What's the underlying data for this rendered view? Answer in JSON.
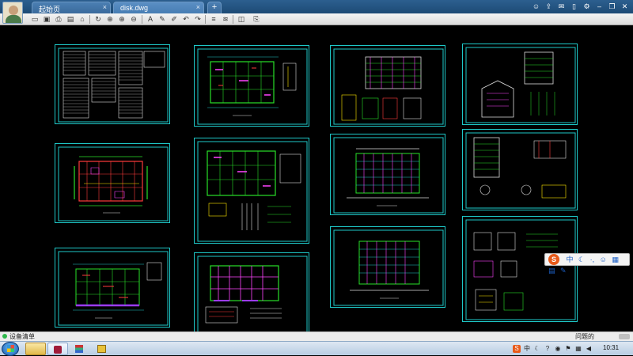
{
  "tabs": [
    {
      "label": "起始页",
      "close": "×"
    },
    {
      "label": "disk.dwg",
      "close": "×"
    }
  ],
  "add_tab_label": "+",
  "toolbar_icons": [
    "open-folder-icon",
    "save-icon",
    "print-icon",
    "print-preview-icon",
    "lock-icon",
    "rotate-icon",
    "zoom-window-icon",
    "zoom-in-icon",
    "zoom-out-icon",
    "text-icon",
    "pen-icon",
    "markup-icon",
    "undo-icon",
    "redo-icon",
    "layer-icon",
    "linetype-icon",
    "layers-stack-icon",
    "export-icon"
  ],
  "ime": {
    "logo": "S",
    "lang": "中"
  },
  "statusbar": {
    "left": "设备清单",
    "right": "问题的"
  },
  "taskbar": {
    "time": "10:31"
  },
  "colors": {
    "sheet_border": "#1ec8c8",
    "titlebar": "#2c5f8f",
    "canvas": "#000000"
  }
}
